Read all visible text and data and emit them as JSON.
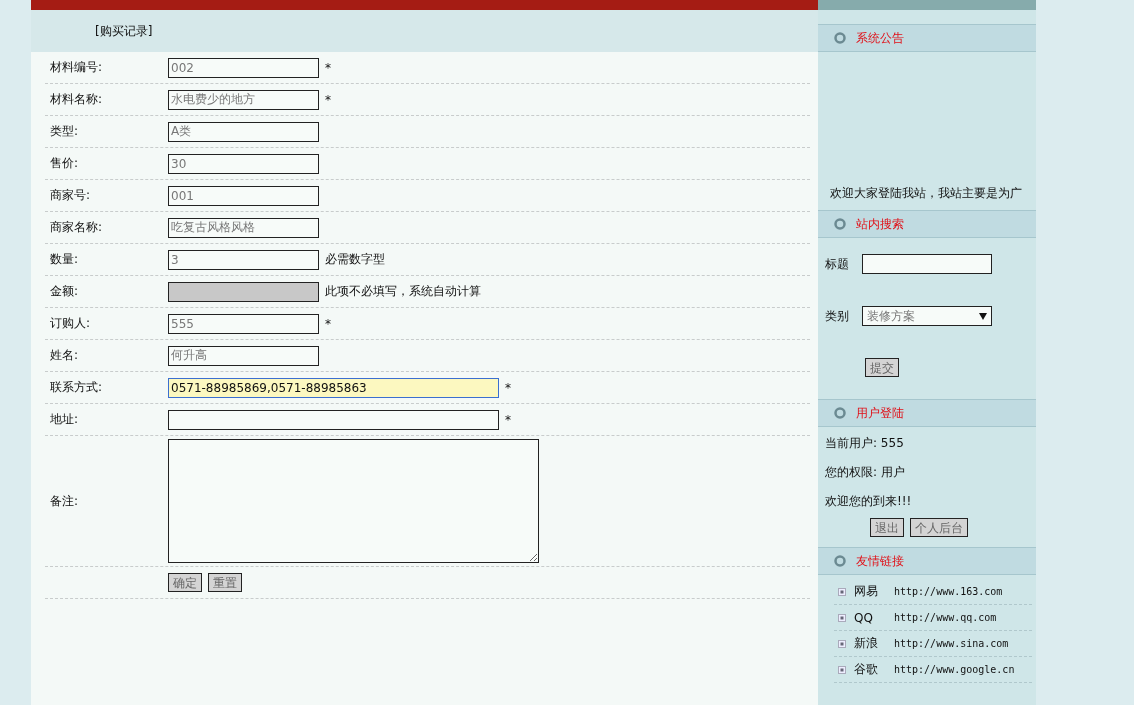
{
  "page_title": "[购买记录]",
  "form": {
    "fields": [
      {
        "label": "材料编号:",
        "kind": "short",
        "value": "002",
        "note": "*"
      },
      {
        "label": "材料名称:",
        "kind": "short",
        "value": "水电费少的地方",
        "note": "*"
      },
      {
        "label": "类型:",
        "kind": "short",
        "value": "A类"
      },
      {
        "label": "售价:",
        "kind": "short",
        "value": "30"
      },
      {
        "label": "商家号:",
        "kind": "short",
        "value": "001"
      },
      {
        "label": "商家名称:",
        "kind": "short",
        "value": "吃复古风格风格"
      },
      {
        "label": "数量:",
        "kind": "short",
        "value": "3",
        "note": "必需数字型"
      },
      {
        "label": "金额:",
        "kind": "short",
        "disabled": true,
        "note": "此项不必填写，系统自动计算"
      },
      {
        "label": "订购人:",
        "kind": "short",
        "value": "555",
        "note": "*"
      },
      {
        "label": "姓名:",
        "kind": "short",
        "value": "何升高"
      },
      {
        "label": "联系方式:",
        "kind": "long",
        "value": "0571-88985869,0571-88985863",
        "focused": true,
        "note": "*"
      },
      {
        "label": "地址:",
        "kind": "long",
        "note": "*"
      },
      {
        "label": "备注:",
        "kind": "textarea"
      }
    ],
    "buttons": [
      "确定",
      "重置"
    ]
  },
  "sidebar": {
    "notice": {
      "title": "系统公告",
      "text": "欢迎大家登陆我站，我站主要是为广"
    },
    "search": {
      "title": "站内搜索",
      "fields": [
        {
          "label": "标题",
          "kind": "text"
        },
        {
          "label": "类别",
          "kind": "select",
          "value": "装修方案"
        }
      ],
      "button": "提交"
    },
    "user": {
      "title": "用户登陆",
      "lines": [
        "当前用户: 555",
        "您的权限: 用户",
        "欢迎您的到来!!!"
      ],
      "buttons": [
        "退出",
        "个人后台"
      ]
    },
    "links": {
      "title": "友情链接",
      "items": [
        {
          "name": "网易",
          "url": "http://www.163.com"
        },
        {
          "name": "QQ",
          "url": "http://www.qq.com"
        },
        {
          "name": "新浪",
          "url": "http://www.sina.com"
        },
        {
          "name": "谷歌",
          "url": "http://www.google.cn"
        }
      ]
    }
  }
}
